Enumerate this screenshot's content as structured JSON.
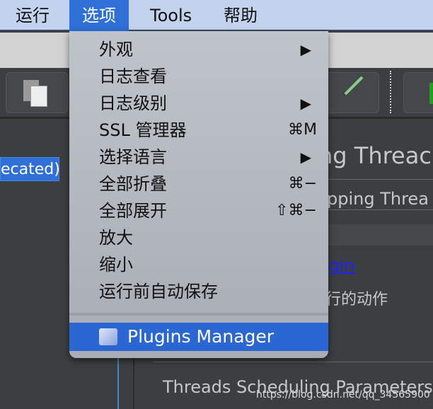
{
  "menubar": {
    "items": [
      "运行",
      "选项",
      "Tools",
      "帮助"
    ],
    "selected": "选项"
  },
  "background": {
    "tree_selected": "ecated)",
    "title": "ng Threac",
    "subtitle": "pping Threa",
    "link": "gin",
    "action_label": "行的动作",
    "section": "Threads Scheduling Parameters"
  },
  "menu": {
    "items": [
      {
        "label": "外观",
        "submenu": true
      },
      {
        "label": "日志查看"
      },
      {
        "label": "日志级别",
        "submenu": true
      },
      {
        "label": "SSL 管理器",
        "shortcut": "⌘M"
      },
      {
        "label": "选择语言",
        "submenu": true
      },
      {
        "label": "全部折叠",
        "shortcut": "⌘−"
      },
      {
        "label": "全部展开",
        "shortcut": "⇧⌘−"
      },
      {
        "label": "放大"
      },
      {
        "label": "缩小"
      },
      {
        "label": "运行前自动保存"
      }
    ],
    "plugins_manager": "Plugins Manager",
    "submenu_arrow": "▶"
  },
  "watermark": "https://blog.csdn.net/qq_34565900",
  "colors": {
    "highlight": "#2a67d3",
    "menubar": "#c3d3ee",
    "link": "#2020ff"
  }
}
